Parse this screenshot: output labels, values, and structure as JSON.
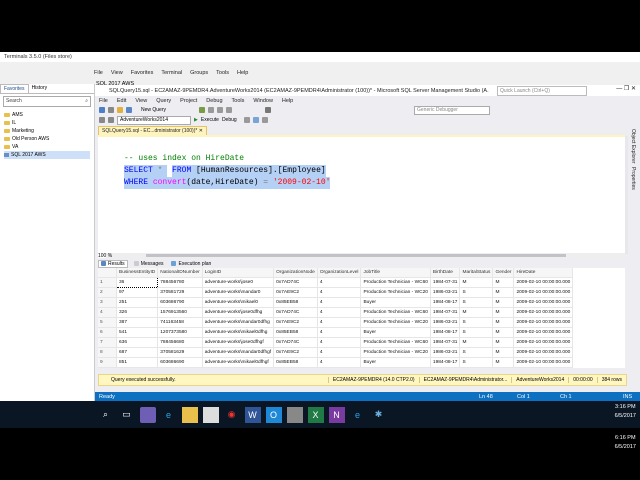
{
  "terminals": {
    "title": "Terminals 3.5.0 (Files store)",
    "menu": [
      "File",
      "View",
      "Favorites",
      "Terminal",
      "Groups",
      "Tools",
      "Help"
    ],
    "session_tab": "SQL 2017 AWS",
    "tabs": [
      "Favorites",
      "History"
    ],
    "search_placeholder": "Search",
    "tree": [
      "AMS",
      "IL",
      "Marketing",
      "Old Person AWS",
      "VA",
      "SQL 2017 AWS"
    ]
  },
  "ssms": {
    "title": "SQLQuery15.sql - EC2AMAZ-9PEMDR4.AdventureWorks2014 (EC2AMAZ-9PEMDR4\\Administrator (100))* - Microsoft SQL Server Management Studio (A...",
    "quick_launch": "Quick Launch (Ctrl+Q)",
    "menu": [
      "File",
      "Edit",
      "View",
      "Query",
      "Project",
      "Debug",
      "Tools",
      "Window",
      "Help"
    ],
    "toolbar": {
      "new_query": "New Query",
      "database": "AdventureWorks2014",
      "execute": "Execute",
      "debug": "Debug",
      "generic_debugger": "Generic Debugger"
    },
    "doc_tab": "SQLQuery15.sql - EC...dministrator (100))*",
    "code": {
      "comment": "-- uses index on HireDate",
      "line1_kw": "SELECT",
      "line1_rest": " *",
      "line2_kw": "FROM",
      "line2_rest": " [HumanResources].[Employee]",
      "line3_kw": "WHERE",
      "line3_fn": " convert",
      "line3_mid": "(date,HireDate)",
      "line3_eq": " = ",
      "line3_str": "'2009-02-10'"
    },
    "side_panels": [
      "Object Explorer",
      "Properties"
    ],
    "zoom": "100 %",
    "result_tabs": [
      "Results",
      "Messages",
      "Execution plan"
    ],
    "grid": {
      "columns": [
        "BusinessEntityID",
        "NationalIDNumber",
        "LoginID",
        "OrganizationNode",
        "OrganizationLevel",
        "JobTitle",
        "BirthDate",
        "MaritalStatus",
        "Gender",
        "HireDate"
      ],
      "rows": [
        [
          "1",
          "36",
          "788456780",
          "adventure-works\\jose0",
          "0x7AD74C",
          "4",
          "Production Technician - WC60",
          "1984-07-31",
          "M",
          "M",
          "2009-02-10 00:00:00.000"
        ],
        [
          "2",
          "97",
          "370581729",
          "adventure-works\\mandar0",
          "0x7AE9C2",
          "4",
          "Production Technician - WC20",
          "1986-03-21",
          "S",
          "M",
          "2009-02-10 00:00:00.000"
        ],
        [
          "3",
          "251",
          "603686790",
          "adventure-works\\mikael0",
          "0x85EB58",
          "4",
          "Buyer",
          "1984-08-17",
          "S",
          "M",
          "2009-02-10 00:00:00.000"
        ],
        [
          "4",
          "326",
          "1576913560",
          "adventure-works\\jose0dfhg",
          "0x7AD74C",
          "4",
          "Production Technician - WC60",
          "1984-07-31",
          "M",
          "M",
          "2009-02-10 00:00:00.000"
        ],
        [
          "5",
          "387",
          "741163458",
          "adventure-works\\mandar0dfhg",
          "0x7AE9C2",
          "4",
          "Production Technician - WC20",
          "1986-03-21",
          "S",
          "M",
          "2009-02-10 00:00:00.000"
        ],
        [
          "6",
          "541",
          "1207373580",
          "adventure-works\\mikael0dfhg",
          "0x85EB58",
          "4",
          "Buyer",
          "1984-08-17",
          "S",
          "M",
          "2009-02-10 00:00:00.000"
        ],
        [
          "7",
          "636",
          "788456680",
          "adventure-works\\jose0dfhgf",
          "0x7AD74C",
          "4",
          "Production Technician - WC60",
          "1984-07-31",
          "M",
          "M",
          "2009-02-10 00:00:00.000"
        ],
        [
          "8",
          "687",
          "370581629",
          "adventure-works\\mandar0dfhgf",
          "0x7AE9C2",
          "4",
          "Production Technician - WC20",
          "1986-03-21",
          "S",
          "M",
          "2009-02-10 00:00:00.000"
        ],
        [
          "9",
          "851",
          "603686690",
          "adventure-works\\mikael0dfhgf",
          "0x85EB58",
          "4",
          "Buyer",
          "1984-08-17",
          "S",
          "M",
          "2009-02-10 00:00:00.000"
        ]
      ]
    },
    "query_status": {
      "message": "Query executed successfully.",
      "server": "EC2AMAZ-9PEMDR4 (14.0 CTP2.0)",
      "user": "EC2AMAZ-9PEMDR4\\Administrator...",
      "db": "AdventureWorks2014",
      "time": "00:00:00",
      "rows": "384 rows"
    },
    "statusbar": {
      "ready": "Ready",
      "ln": "Ln 48",
      "col": "Col 1",
      "ch": "Ch 1",
      "ins": "INS"
    }
  },
  "taskbar": {
    "time1": "3:16 PM",
    "date1": "6/5/2017",
    "time2": "6:16 PM",
    "date2": "6/5/2017"
  },
  "colors": {
    "status_blue": "#0e70c0",
    "keyword": "#0000ff",
    "comment": "#008000",
    "string": "#ff0000",
    "function": "#ff00ff"
  }
}
